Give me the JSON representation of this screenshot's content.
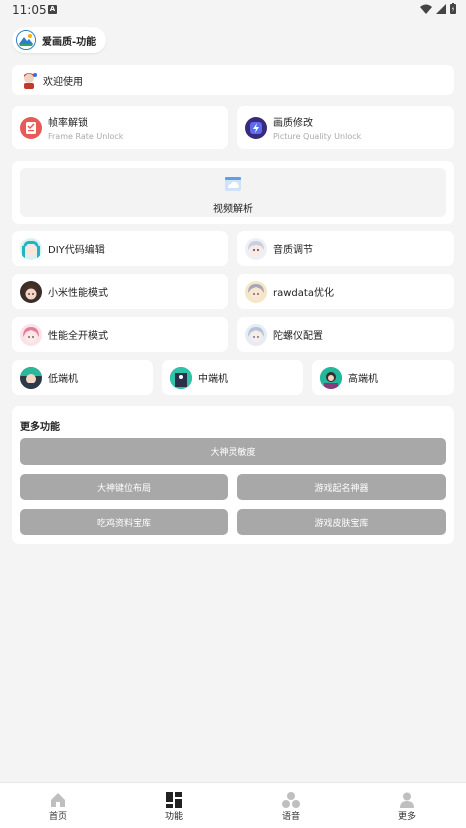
{
  "status_bar": {
    "time": "11:05"
  },
  "header": {
    "title": "爱画质-功能"
  },
  "welcome": {
    "label": "欢迎使用"
  },
  "feature_cards": [
    {
      "title": "帧率解锁",
      "subtitle": "Frame Rate Unlock"
    },
    {
      "title": "画质修改",
      "subtitle": "Picture Quality Unlock"
    }
  ],
  "video": {
    "label": "视频解析"
  },
  "grid_items": [
    {
      "label": "DIY代码编辑"
    },
    {
      "label": "音质调节"
    },
    {
      "label": "小米性能模式"
    },
    {
      "label": "rawdata优化"
    },
    {
      "label": "性能全开模式"
    },
    {
      "label": "陀螺仪配置"
    }
  ],
  "tiers": [
    {
      "label": "低端机"
    },
    {
      "label": "中端机"
    },
    {
      "label": "高端机"
    }
  ],
  "more": {
    "title": "更多功能",
    "buttons": [
      "大神灵敏度",
      "大神键位布局",
      "游戏起名神器",
      "吃鸡资料宝库",
      "游戏皮肤宝库"
    ]
  },
  "bottom_nav": [
    {
      "label": "首页",
      "icon": "home-icon"
    },
    {
      "label": "功能",
      "icon": "grid-icon"
    },
    {
      "label": "语音",
      "icon": "voice-icon"
    },
    {
      "label": "更多",
      "icon": "person-icon"
    }
  ],
  "colors": {
    "background": "#f4f4f4",
    "card": "#ffffff",
    "button_gray": "#a8a8a8",
    "accent_blue": "#2a7fc8"
  }
}
